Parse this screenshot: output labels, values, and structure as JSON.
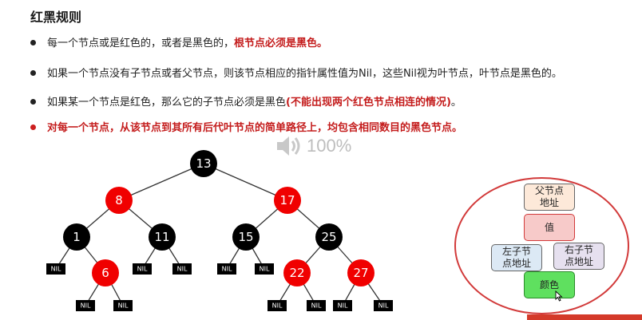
{
  "title": "红黑规则",
  "bullets": [
    {
      "text": "每一个节点或是红色的，或者是黑色的，",
      "emph": "根节点必须是黑色。"
    },
    {
      "text": "如果一个节点没有子节点或者父节点，则该节点相应的指针属性值为Nil，这些Nil视为叶节点，叶节点是黑色的。"
    },
    {
      "text": "如果某一个节点是红色，那么它的子节点必须是黑色",
      "emph": "(不能出现两个红色节点相连的情况)",
      "tail": "。"
    },
    {
      "text": "对每一个节点，从该节点到其所有后代叶节点的简单路径上，均包含相同数目的黑色节点。"
    }
  ],
  "volume": {
    "icon": "speaker-icon",
    "percent": "100%"
  },
  "tree": {
    "nodes": [
      {
        "label": "13",
        "color": "black"
      },
      {
        "label": "8",
        "color": "red"
      },
      {
        "label": "17",
        "color": "red"
      },
      {
        "label": "1",
        "color": "black"
      },
      {
        "label": "11",
        "color": "black"
      },
      {
        "label": "15",
        "color": "black"
      },
      {
        "label": "25",
        "color": "black"
      },
      {
        "label": "6",
        "color": "red"
      },
      {
        "label": "22",
        "color": "red"
      },
      {
        "label": "27",
        "color": "red"
      }
    ],
    "nil_label": "NIL"
  },
  "structure": {
    "parent": "父节点\n地址",
    "value": "值",
    "left": "左子节\n点地址",
    "right": "右子节\n点地址",
    "color": "颜色"
  },
  "colors": {
    "red_node": "#f00000",
    "black_node": "#000000",
    "accent_red": "#c41c1c",
    "box_parent": "#fde9d9",
    "box_value": "#f7cac9",
    "box_left": "#dce9f5",
    "box_right": "#e6e0ef",
    "box_color": "#5fe05f"
  }
}
